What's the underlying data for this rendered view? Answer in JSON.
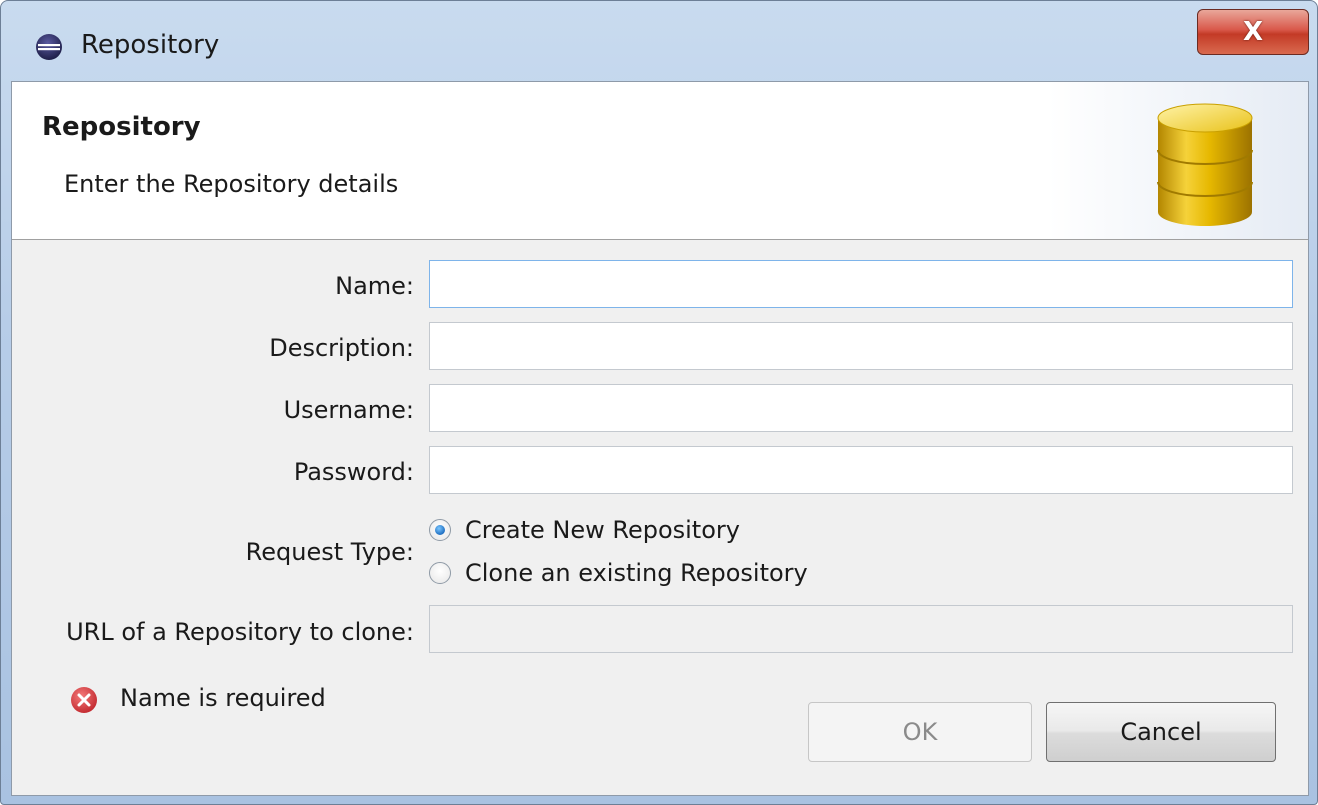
{
  "window": {
    "title": "Repository",
    "close_label": "X"
  },
  "banner": {
    "title": "Repository",
    "description": "Enter the Repository details",
    "icon": "database-icon"
  },
  "form": {
    "name": {
      "label": "Name:",
      "value": "",
      "placeholder": ""
    },
    "description": {
      "label": "Description:",
      "value": "",
      "placeholder": ""
    },
    "username": {
      "label": "Username:",
      "value": "",
      "placeholder": ""
    },
    "password": {
      "label": "Password:",
      "value": "",
      "placeholder": ""
    },
    "request_type": {
      "label": "Request Type:",
      "options": [
        {
          "label": "Create New Repository",
          "selected": true
        },
        {
          "label": "Clone an existing Repository",
          "selected": false
        }
      ]
    },
    "clone_url": {
      "label": "URL of a Repository to clone:",
      "value": "",
      "enabled": false
    }
  },
  "status": {
    "error_message": "Name is required",
    "icon": "error-icon"
  },
  "buttons": {
    "ok_label": "OK",
    "ok_enabled": false,
    "cancel_label": "Cancel"
  },
  "colors": {
    "titlebar": "#b7cde8",
    "close_button": "#c33a26",
    "database_icon": "#e6b800",
    "error_icon": "#d9363e",
    "radio_selected": "#1f6fc2"
  }
}
